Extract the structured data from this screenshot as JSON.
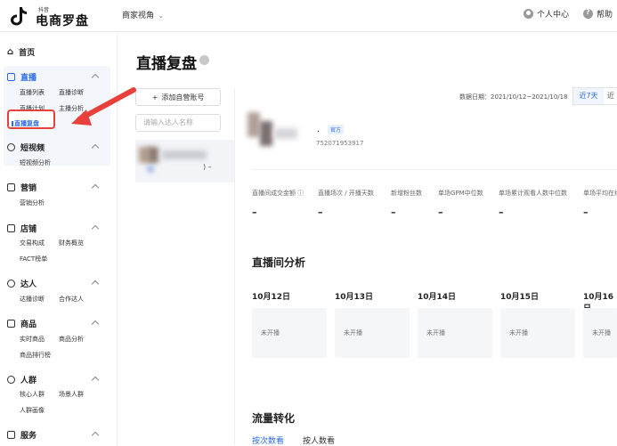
{
  "header": {
    "logo_small": "抖音",
    "logo_text": "电商罗盘",
    "view_switch": "商家视角",
    "user_center": "个人中心",
    "help": "帮助"
  },
  "sidebar": {
    "home": "首页",
    "live": {
      "title": "直播",
      "items": [
        "直播列表",
        "直播诊断",
        "直播计划",
        "主播分析",
        "直播复盘"
      ]
    },
    "video": {
      "title": "短视频",
      "items": [
        "短视频分析"
      ]
    },
    "marketing": {
      "title": "营销",
      "items": [
        "营销分析"
      ]
    },
    "store": {
      "title": "店铺",
      "items": [
        "交易构成",
        "财务概览",
        "FACT榜单"
      ]
    },
    "talent": {
      "title": "达人",
      "items": [
        "达播诊断",
        "合作达人"
      ]
    },
    "product": {
      "title": "商品",
      "items": [
        "实时商品",
        "商品分析",
        "商品排行榜"
      ]
    },
    "crowd": {
      "title": "人群",
      "items": [
        "核心人群",
        "场景人群",
        "人群画像"
      ]
    },
    "service": {
      "title": "服务",
      "items": []
    }
  },
  "page": {
    "title": "直播复盘",
    "add_button": "添加自营账号",
    "search_placeholder": "请输入达人名称",
    "date_label": "数据日期：2021/10/12~2021/10/18",
    "range_active": "近7天",
    "range_other": "近",
    "official_tag": "官方",
    "account_id": "752071953917",
    "account_suffix": ") –"
  },
  "metrics": [
    {
      "label": "直播间成交金额 ⓘ",
      "value": "–"
    },
    {
      "label": "直播场次 / 开播天数",
      "value": "–"
    },
    {
      "label": "新增粉丝数",
      "value": "–"
    },
    {
      "label": "单场GPM中位数",
      "value": "–"
    },
    {
      "label": "单场累计观看人数中位数",
      "value": "–"
    },
    {
      "label": "单场平均在线",
      "value": "–"
    }
  ],
  "analysis": {
    "title": "直播间分析",
    "days": [
      {
        "date": "10月12日",
        "status": "未开播"
      },
      {
        "date": "10月13日",
        "status": "未开播"
      },
      {
        "date": "10月14日",
        "status": "未开播"
      },
      {
        "date": "10月15日",
        "status": "未开播"
      },
      {
        "date": "10月16日",
        "status": "未开播"
      }
    ]
  },
  "traffic": {
    "title": "流量转化",
    "tab_active": "按次数看",
    "tab_other": "按人数看"
  },
  "colors": {
    "accent": "#2b6ae8",
    "annotation": "#e8413b"
  }
}
